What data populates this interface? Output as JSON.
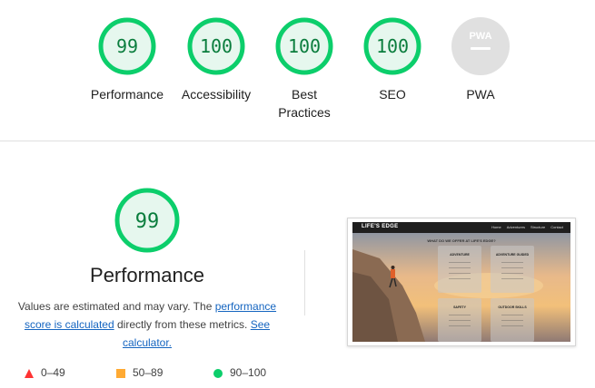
{
  "categories": [
    {
      "label": "Performance",
      "score": "99",
      "state": "pass"
    },
    {
      "label": "Accessibility",
      "score": "100",
      "state": "pass"
    },
    {
      "label": "Best Practices",
      "score": "100",
      "state": "pass"
    },
    {
      "label": "SEO",
      "score": "100",
      "state": "pass"
    },
    {
      "label": "PWA",
      "score": "PWA",
      "state": "na"
    }
  ],
  "performance": {
    "score": "99",
    "title": "Performance",
    "desc_prefix": "Values are estimated and may vary. The ",
    "desc_link1": "performance score is calculated",
    "desc_middle": " directly from these metrics. ",
    "desc_link2": "See calculator."
  },
  "legend": [
    {
      "range": "0–49",
      "icon": "red-triangle-icon",
      "color": "#ff3333"
    },
    {
      "range": "50–89",
      "icon": "orange-square-icon",
      "color": "#ffaa33"
    },
    {
      "range": "90–100",
      "icon": "green-circle-icon",
      "color": "#0cce6b"
    }
  ],
  "screenshot": {
    "brand": "LIFE'S EDGE",
    "nav_links": [
      "Home",
      "Adventures",
      "Structure",
      "Contact"
    ],
    "heading": "WHAT DO WE OFFER AT LIFE'S EDGE?",
    "cards": [
      "ADVENTURE",
      "ADVENTURE GUIDED",
      "SAFETY",
      "OUTDOOR SKILLS"
    ]
  },
  "colors": {
    "pass": "#0cce6b",
    "pass_bg": "#e6f7ee",
    "pass_text": "#0a7d3d",
    "na_bg": "#e0e0e0"
  }
}
